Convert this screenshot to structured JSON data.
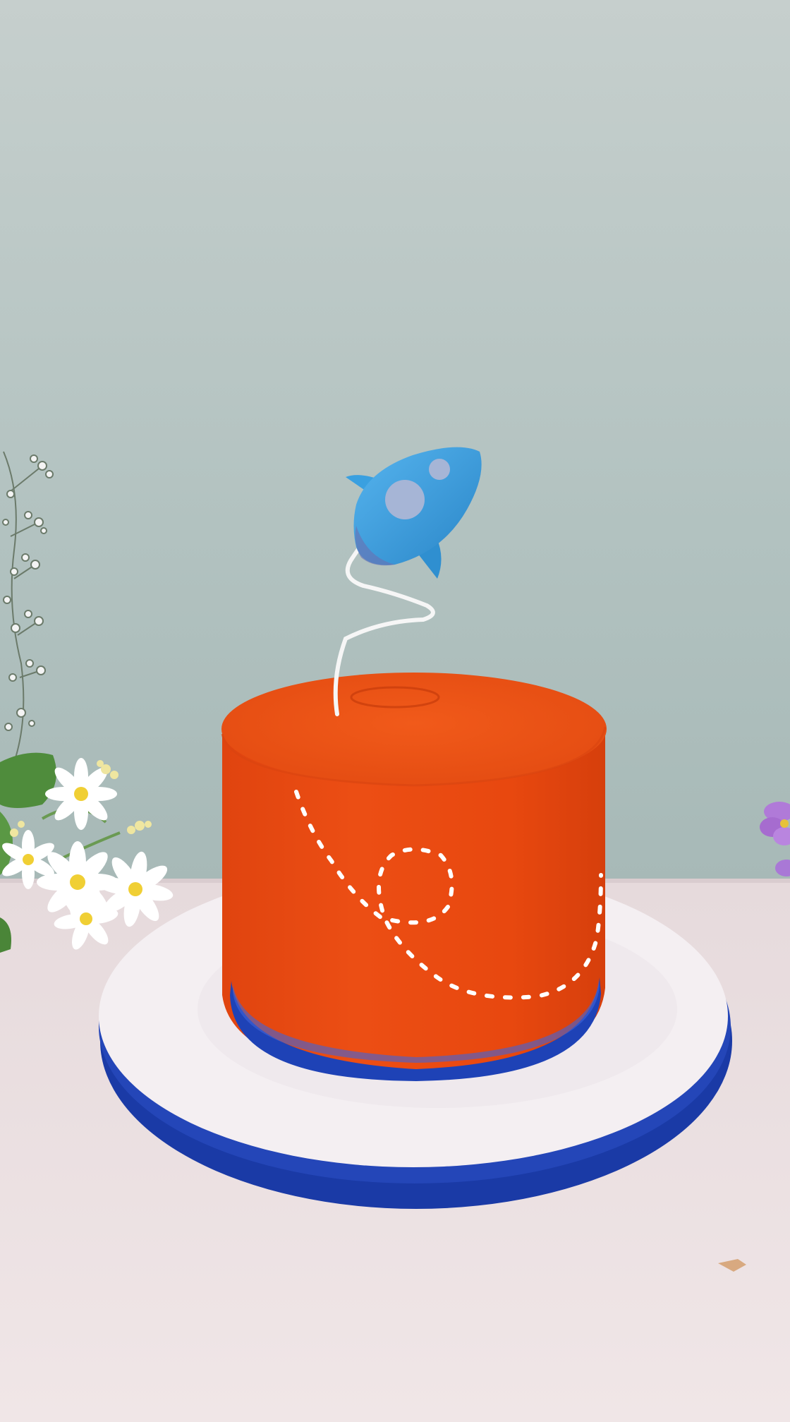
{
  "photo": {
    "subject": "orange-frosted-cake-with-rocket-topper",
    "colors": {
      "wall_top": "#c4cecc",
      "wall_bottom": "#a8bab8",
      "table": "#eadfe0",
      "table_shadow": "#d8c9cb",
      "cake_body": "#ea4a12",
      "cake_top": "#ec5416",
      "cake_shadow": "#c93c0c",
      "ribbon": "#1c3fb0",
      "ribbon_highlight": "#3a5fd6",
      "board": "#f3eef1",
      "rocket": "#3aa0e0",
      "rocket_dark": "#2b86c6",
      "rocket_window": "#a9b8d8",
      "dashes": "#ffffff",
      "flower_petal": "#ffffff",
      "flower_center": "#f2d23a",
      "leaf": "#4e8a3a",
      "purple_flower": "#b07ad8"
    }
  }
}
